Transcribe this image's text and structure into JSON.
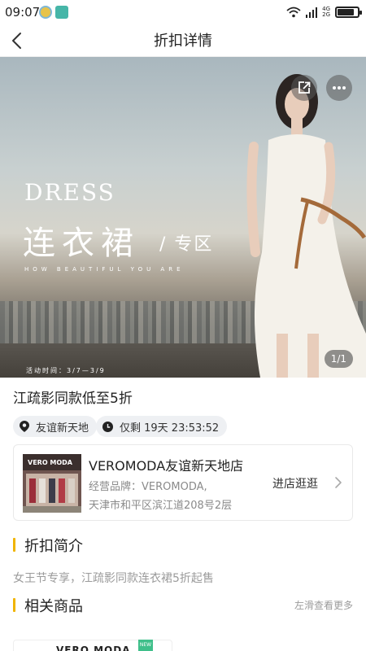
{
  "status_bar": {
    "time": "09:07",
    "network_top": "4G",
    "network_bottom": "2G",
    "battery_level": 0.85
  },
  "nav": {
    "title": "折扣详情",
    "back_icon": "chevron-left-icon"
  },
  "banner": {
    "dress_title": "DRESS",
    "zh_title": "连衣裙",
    "zh_sub": "/ 专区",
    "en_sub": "HOW BEAUTIFUL YOU ARE",
    "date": "活动时间：3/7—3/9",
    "pager": "1/1",
    "share_icon": "share-icon",
    "more_icon": "more-icon"
  },
  "promo": {
    "title": "江疏影同款低至5折",
    "location": "友谊新天地",
    "countdown": "仅剩 19天 23:53:52"
  },
  "store": {
    "name": "VEROMODA友谊新天地店",
    "brand": "经营品牌：VEROMODA,",
    "address": "天津市和平区滨江道208号2层",
    "enter_label": "进店逛逛",
    "thumb_sign": "VERO MODA"
  },
  "discount_section": {
    "title": "折扣简介",
    "text": "女王节专享，江疏影同款连衣裙5折起售"
  },
  "related_section": {
    "title": "相关商品",
    "more_hint": "左滑查看更多"
  },
  "product": {
    "brand": "VERO MODA",
    "badge": "NEW"
  },
  "colors": {
    "accent": "#f0b400",
    "muted_text": "#9b9b9b",
    "chip_bg": "#eef0f3"
  }
}
